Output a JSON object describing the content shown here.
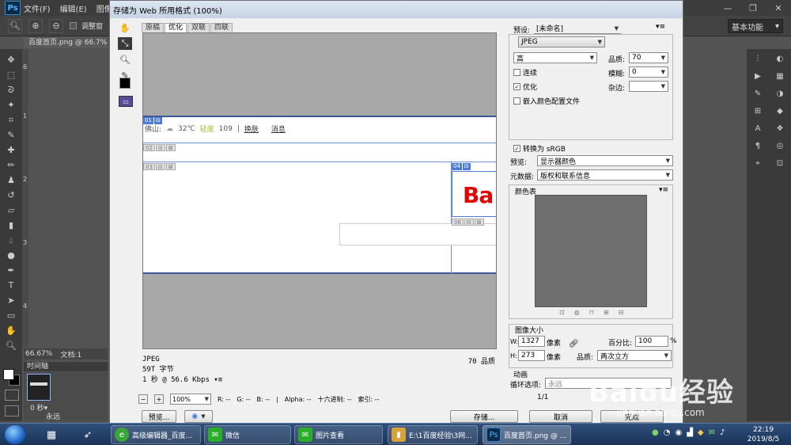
{
  "ps": {
    "menus": [
      "文件(F)",
      "编辑(E)",
      "图像"
    ],
    "option_label": "调整窗",
    "workspace": "基本功能",
    "doc_tab": "百度首页.png @ 66.7% (",
    "zoom": "66.67%",
    "doc_label": "文档:1",
    "timeline_tab": "时间轴",
    "frame_delay": "0 秒▾",
    "loop": "永远",
    "ruler_marks": [
      "6",
      "1",
      "2",
      "3",
      "4"
    ]
  },
  "dialog": {
    "title": "存储为 Web 所用格式 (100%)",
    "tabs": [
      "原稿",
      "优化",
      "双联",
      "四联"
    ],
    "active_tab": 1,
    "slices": {
      "s01": "01",
      "s02": "02",
      "s03": "03",
      "s04": "04",
      "s06": "06"
    },
    "web": {
      "city": "佛山:",
      "temp": "32℃",
      "aqi_label": "轻度",
      "aqi_value": "109",
      "sep": "|",
      "link1": "换肤",
      "link2": "消息",
      "logo": "Ba"
    },
    "info": {
      "format": "JPEG",
      "size": "59T 字节",
      "time": "1 秒 @ 56.6 Kbps ▾≡",
      "quality": "70 品质"
    },
    "status": {
      "zoom": "100%",
      "r": "R: --",
      "g": "G: --",
      "b": "B: --",
      "alpha": "Alpha: --",
      "hex": "十六进制: --",
      "index": "索引: --"
    },
    "buttons": {
      "preview": "预览...",
      "save": "存储...",
      "cancel": "取消",
      "done": "完成"
    },
    "panel": {
      "preset_label": "预设:",
      "preset_value": "[未命名]",
      "format": "JPEG",
      "quality_level": "高",
      "quality_label": "品质:",
      "quality_value": "70",
      "progressive": "连续",
      "blur_label": "模糊:",
      "blur_value": "0",
      "optimized": "优化",
      "matte_label": "杂边:",
      "embed_profile": "嵌入颜色配置文件",
      "convert_srgb": "转换为 sRGB",
      "preview_label": "预览:",
      "preview_value": "显示器颜色",
      "metadata_label": "元数据:",
      "metadata_value": "版权和联系信息",
      "color_table": "颜色表",
      "image_size": "图像大小",
      "w_label": "W:",
      "w_value": "1327",
      "h_label": "H:",
      "h_value": "273",
      "unit": "像素",
      "percent_label": "百分比:",
      "percent_value": "100",
      "percent_unit": "%",
      "resample_label": "品质:",
      "resample_value": "两次立方",
      "animation": "动画",
      "loop_label": "循环选项:",
      "loop_value": "永远",
      "frame_count": "1/1"
    }
  },
  "taskbar": {
    "tasks": [
      {
        "label": "高级编辑器_百度...",
        "color": "#3aa63a",
        "icon": "e"
      },
      {
        "label": "微信",
        "color": "#2aae2a",
        "icon": "✉"
      },
      {
        "label": "图片查看",
        "color": "#2aae2a",
        "icon": "✉"
      },
      {
        "label": "E:\\1百度经验\\3网...",
        "color": "#d9a13a",
        "icon": "▮"
      },
      {
        "label": "百度首页.png @ ...",
        "color": "#0c2a4a",
        "icon": "Ps"
      }
    ],
    "time": "22:19",
    "date": "2019/8/5"
  },
  "watermark": {
    "logo": "Baidu经验",
    "url": "jingyan.baidu.com"
  }
}
